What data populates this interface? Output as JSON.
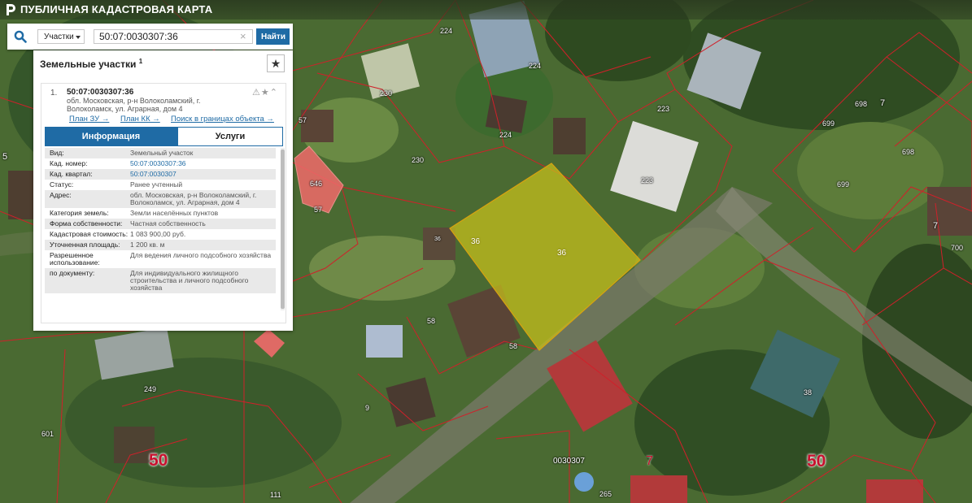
{
  "app": {
    "title": "ПУБЛИЧНАЯ КАДАСТРОВАЯ КАРТА"
  },
  "search": {
    "type_label": "Участки",
    "query": "50:07:0030307:36",
    "button_label": "Найти",
    "clear_symbol": "×"
  },
  "panel": {
    "title": "Земельные участки",
    "count": "1",
    "favorite_symbol": "★",
    "result": {
      "index": "1.",
      "cad_number": "50:07:0030307:36",
      "address": "обл. Московская, р-н Волоколамский, г. Волоколамск, ул. Аграрная, дом 4",
      "icons": "⚠★⌃",
      "links": [
        "План ЗУ →",
        "План КК →",
        "Поиск в границах объекта →"
      ],
      "tabs": [
        "Информация",
        "Услуги"
      ],
      "rows": [
        {
          "key": "Вид:",
          "value": "Земельный участок"
        },
        {
          "key": "Кад. номер:",
          "value": "50:07:0030307:36"
        },
        {
          "key": "Кад. квартал:",
          "value": "50:07:0030307"
        },
        {
          "key": "Статус:",
          "value": "Ранее учтенный"
        },
        {
          "key": "Адрес:",
          "value": "обл. Московская, р-н Волоколамский, г. Волоколамск, ул. Аграрная, дом 4"
        },
        {
          "key": "Категория земель:",
          "value": "Земли населённых пунктов"
        },
        {
          "key": "Форма собственности:",
          "value": "Частная собственность"
        },
        {
          "key": "Кадастровая стоимость:",
          "value": "1 083 900,00 руб."
        },
        {
          "key": "Уточненная площадь:",
          "value": "1 200 кв. м"
        },
        {
          "key": "Разрешенное использование:",
          "value": "Для ведения личного подсобного хозяйства"
        },
        {
          "key": "по документу:",
          "value": "Для индивидуального жилищного строительства и личного подсобного хозяйства"
        }
      ]
    }
  },
  "map": {
    "parcel_labels": [
      "224",
      "224",
      "224",
      "230",
      "230",
      "223",
      "223",
      "57",
      "57",
      "646",
      "36",
      "58",
      "58",
      "249",
      "9",
      "601",
      "111",
      "265",
      "0030307",
      "38",
      "698",
      "7",
      "699",
      "698",
      "699",
      "7",
      "700",
      "5"
    ],
    "highlight_labels": [
      "36",
      "36"
    ],
    "quarter_labels": [
      "50",
      "50"
    ],
    "district_label": "7"
  },
  "colors": {
    "accent": "#1f6ba5",
    "parcel_border": "#d0202a",
    "selected_fill": "#c9c21b",
    "pink_parcel": "#f06a6a"
  }
}
